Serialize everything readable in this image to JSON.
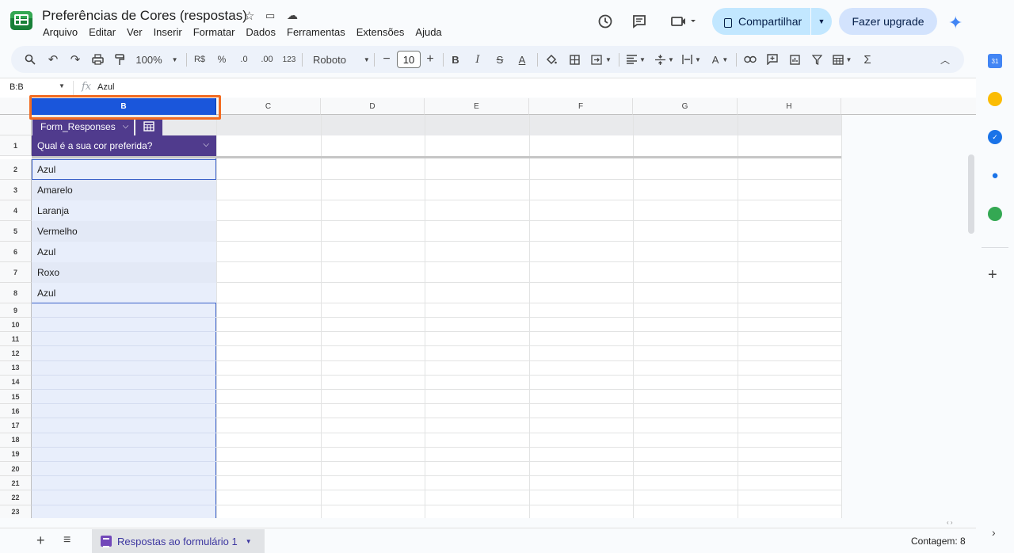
{
  "header": {
    "title": "Preferências de Cores (respostas)",
    "menu": [
      "Arquivo",
      "Editar",
      "Ver",
      "Inserir",
      "Formatar",
      "Dados",
      "Ferramentas",
      "Extensões",
      "Ajuda"
    ],
    "share_label": "Compartilhar",
    "upgrade_label": "Fazer upgrade"
  },
  "toolbar": {
    "zoom": "100%",
    "currency": "R$",
    "percent": "%",
    "dec_decrease": ".0",
    "dec_increase": ".00",
    "number_format": "123",
    "font": "Roboto",
    "font_size": "10"
  },
  "formula_bar": {
    "name_box": "B:B",
    "fx": "fx",
    "formula": "Azul"
  },
  "grid": {
    "columns": [
      "B",
      "C",
      "D",
      "E",
      "F",
      "G",
      "H"
    ],
    "rows": [
      "1",
      "2",
      "3",
      "4",
      "5",
      "6",
      "7",
      "8",
      "9",
      "10",
      "11",
      "12",
      "13",
      "14",
      "15",
      "16",
      "17",
      "18",
      "19",
      "20",
      "21",
      "22",
      "23"
    ],
    "table_name": "Form_Responses",
    "table_header": "Qual é a sua cor preferida?",
    "values": [
      "Azul",
      "Amarelo",
      "Laranja",
      "Vermelho",
      "Azul",
      "Roxo",
      "Azul"
    ]
  },
  "bottom": {
    "sheet_tab": "Respostas ao formulário 1",
    "status": "Contagem: 8"
  },
  "colors": {
    "table_purple": "#503b8d",
    "selection_blue": "#1a56db",
    "highlight_orange": "#f26b21"
  }
}
